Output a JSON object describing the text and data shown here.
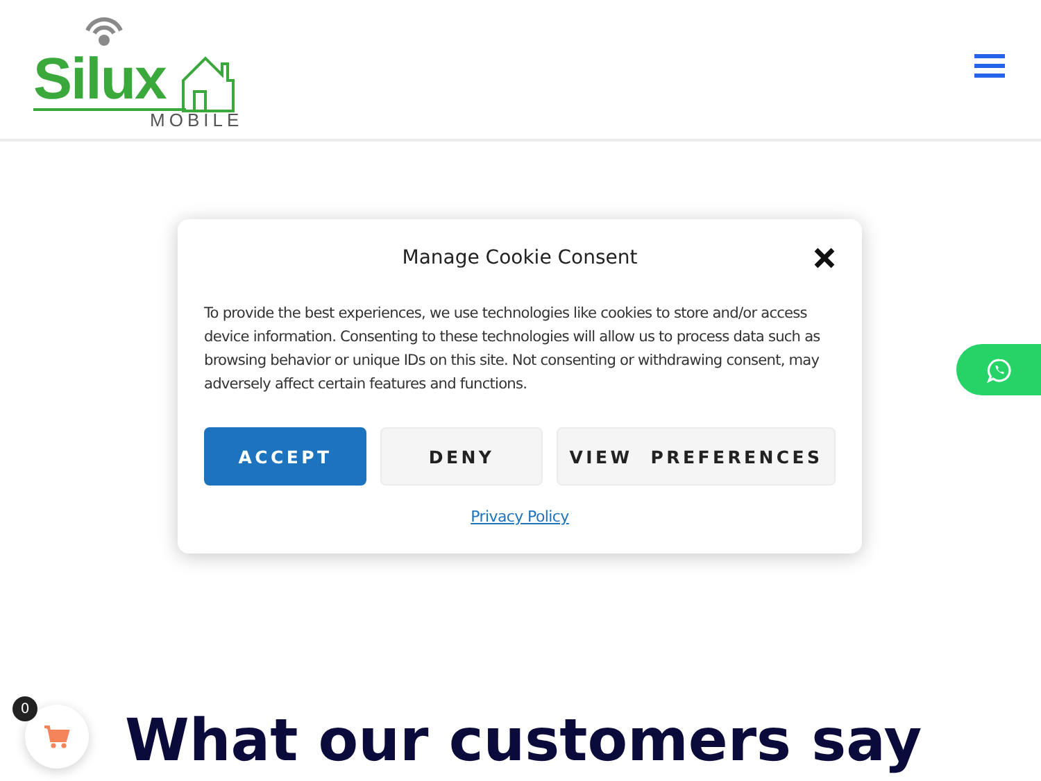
{
  "logo": {
    "name": "Silux",
    "tagline": "MOBILE"
  },
  "cookie_dialog": {
    "title": "Manage Cookie Consent",
    "text": "To provide the best experiences, we use technologies like cookies to store and/or access device information. Consenting to these technologies will allow us to process data such as browsing behavior or unique IDs on this site. Not consenting or withdrawing consent, may adversely affect certain features and functions.",
    "buttons": [
      {
        "label": "ACCEPT",
        "kind": "primary"
      },
      {
        "label": "DENY",
        "kind": "secondary"
      },
      {
        "label": "VIEW  PREFERENCES",
        "kind": "secondary"
      }
    ],
    "link": "Privacy Policy"
  },
  "cart": {
    "count": "0"
  },
  "heading": "What our customers say"
}
